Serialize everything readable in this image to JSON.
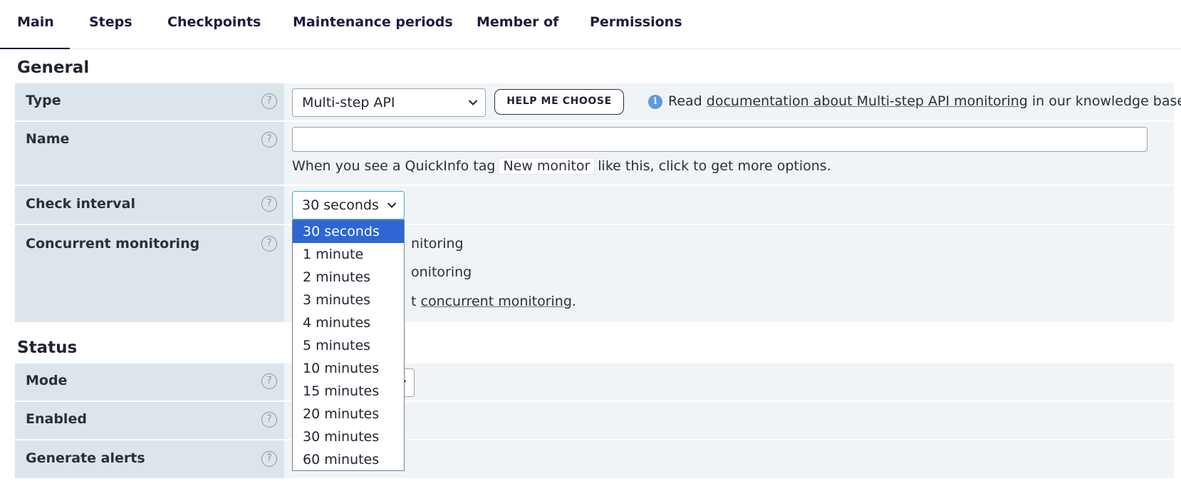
{
  "tabs": [
    "Main",
    "Steps",
    "Checkpoints",
    "Maintenance periods",
    "Member of",
    "Permissions"
  ],
  "active_tab": "Main",
  "general": {
    "title": "General",
    "type": {
      "label": "Type",
      "value": "Multi-step API",
      "help_button": "HELP ME CHOOSE",
      "info_prefix": "Read",
      "info_link": "documentation about Multi-step API monitoring",
      "info_suffix": "in our knowledge base."
    },
    "name": {
      "label": "Name",
      "value": "",
      "hint_prefix": "When you see a QuickInfo tag",
      "hint_tag": "New monitor",
      "hint_suffix": "like this, click to get more options."
    },
    "check_interval": {
      "label": "Check interval",
      "value": "30 seconds",
      "options": [
        "30 seconds",
        "1 minute",
        "2 minutes",
        "3 minutes",
        "4 minutes",
        "5 minutes",
        "10 minutes",
        "15 minutes",
        "20 minutes",
        "30 minutes",
        "60 minutes"
      ],
      "selected_index": 0
    },
    "concurrent": {
      "label": "Concurrent monitoring",
      "line1_visible": "nitoring",
      "line2_visible": "onitoring",
      "line3_visible": "t",
      "line3_link": "concurrent monitoring",
      "line3_end": "."
    }
  },
  "status": {
    "title": "Status",
    "mode_label": "Mode",
    "enabled_label": "Enabled",
    "alerts_label": "Generate alerts"
  },
  "icons": {
    "help": "?",
    "info": "i",
    "chevron": "chevron-down"
  }
}
